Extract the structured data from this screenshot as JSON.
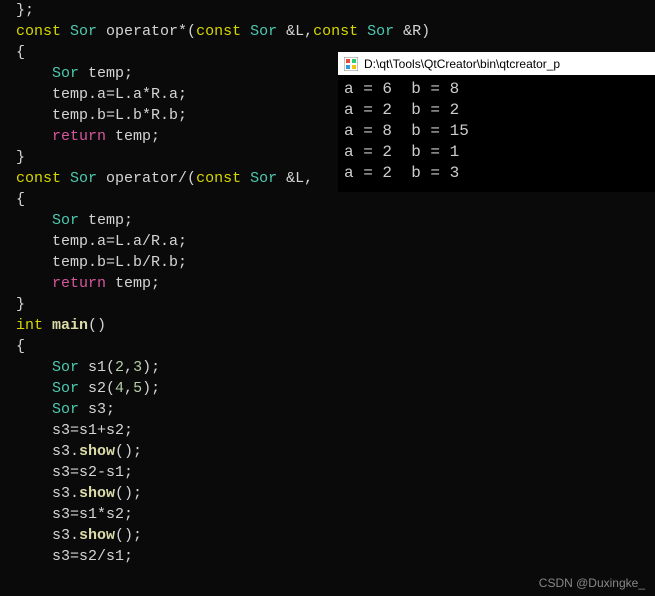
{
  "code": {
    "l0": "};",
    "l1_kw1": "const",
    "l1_type1": " Sor ",
    "l1_op": "operator*",
    "l1_p1": "(",
    "l1_kw2": "const",
    "l1_type2": " Sor ",
    "l1_ref1": "&L,",
    "l1_kw3": "const",
    "l1_type3": " Sor ",
    "l1_ref2": "&R)",
    "l2": "{",
    "l3_type": "    Sor ",
    "l3_rest": "temp;",
    "l4": "    temp.a=L.a*R.a;",
    "l5": "    temp.b=L.b*R.b;",
    "l6_ret": "    return",
    "l6_rest": " temp;",
    "l7": "}",
    "l8_kw1": "const",
    "l8_type1": " Sor ",
    "l8_op": "operator/",
    "l8_p1": "(",
    "l8_kw2": "const",
    "l8_type2": " Sor ",
    "l8_ref1": "&L,",
    "l9": "{",
    "l10_type": "    Sor ",
    "l10_rest": "temp;",
    "l11": "    temp.a=L.a/R.a;",
    "l12": "    temp.b=L.b/R.b;",
    "l13_ret": "    return",
    "l13_rest": " temp;",
    "l14": "}",
    "l15_kw": "int ",
    "l15_fn": "main",
    "l15_rest": "()",
    "l16": "{",
    "l17_type": "    Sor ",
    "l17_var": "s1(",
    "l17_n1": "2",
    "l17_c": ",",
    "l17_n2": "3",
    "l17_end": ");",
    "l18_type": "    Sor ",
    "l18_var": "s2(",
    "l18_n1": "4",
    "l18_c": ",",
    "l18_n2": "5",
    "l18_end": ");",
    "l19_type": "    Sor ",
    "l19_rest": "s3;",
    "l20": "    s3=s1+s2;",
    "l21_pre": "    s3.",
    "l21_fn": "show",
    "l21_end": "();",
    "l22": "    s3=s2-s1;",
    "l23_pre": "    s3.",
    "l23_fn": "show",
    "l23_end": "();",
    "l24": "    s3=s1*s2;",
    "l25_pre": "    s3.",
    "l25_fn": "show",
    "l25_end": "();",
    "l26": "    s3=s2/s1;"
  },
  "console": {
    "title": "D:\\qt\\Tools\\QtCreator\\bin\\qtcreator_p",
    "lines": [
      "a = 6  b = 8",
      "a = 2  b = 2",
      "a = 8  b = 15",
      "a = 2  b = 1",
      "a = 2  b = 3"
    ]
  },
  "watermark": "CSDN @Duxingke_"
}
